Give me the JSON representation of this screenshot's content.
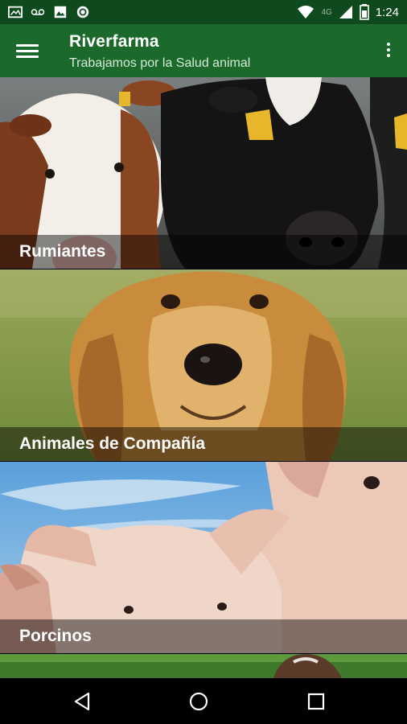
{
  "status_bar": {
    "notification_icons": [
      "image-notification-icon",
      "voicemail-icon",
      "photo-icon",
      "record-icon"
    ],
    "network_label": "4G",
    "time": "1:24"
  },
  "app_bar": {
    "title": "Riverfarma",
    "subtitle": "Trabajamos por la Salud animal",
    "menu_icon": "hamburger-menu-icon",
    "overflow_icon": "more-vert-icon",
    "color": "#1b6a2b"
  },
  "categories": [
    {
      "label": "Rumiantes",
      "image": "cows-photo"
    },
    {
      "label": "Animales de Compañía",
      "image": "dog-photo"
    },
    {
      "label": "Porcinos",
      "image": "pigs-photo"
    },
    {
      "label": "",
      "image": "horse-photo"
    }
  ],
  "nav_bar": {
    "icons": [
      "back-icon",
      "home-icon",
      "recents-icon"
    ]
  }
}
